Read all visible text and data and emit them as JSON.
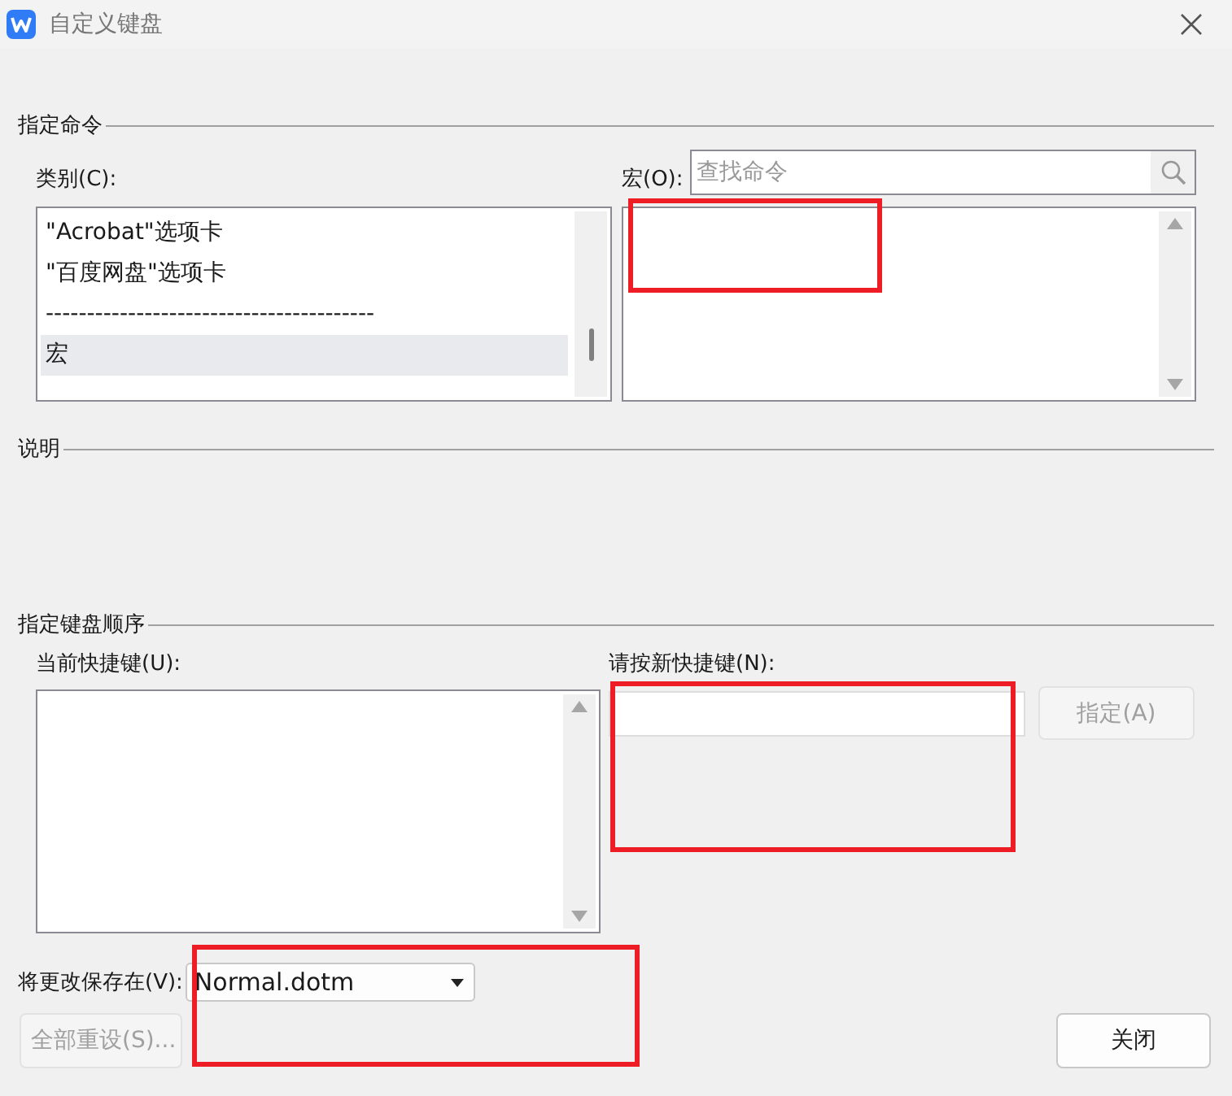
{
  "window": {
    "title": "自定义键盘"
  },
  "assign_command": {
    "heading": "指定命令",
    "categories": {
      "label": "类别(C):",
      "items": [
        {
          "text": "\"Acrobat\"选项卡",
          "selected": false
        },
        {
          "text": "\"百度网盘\"选项卡",
          "selected": false
        },
        {
          "text": "----------------------------------------",
          "selected": false
        },
        {
          "text": "宏",
          "selected": true
        }
      ]
    },
    "macros": {
      "label": "宏(O):",
      "search": {
        "placeholder": "查找命令"
      }
    }
  },
  "description": {
    "heading": "说明"
  },
  "key_sequence": {
    "heading": "指定键盘顺序",
    "current_label": "当前快捷键(U):",
    "new_label": "请按新快捷键(N):",
    "assign_button": {
      "label": "指定(A)",
      "disabled": true
    }
  },
  "save_in": {
    "label": "将更改保存在(V):",
    "value": "Normal.dotm"
  },
  "buttons": [
    {
      "label": "全部重设(S)...",
      "disabled": true
    },
    {
      "label": "关闭",
      "disabled": false
    }
  ],
  "highlight_boxes": [
    {
      "color": "#ee1c25"
    },
    {
      "color": "#ee1c25"
    },
    {
      "color": "#ee1c25"
    }
  ]
}
